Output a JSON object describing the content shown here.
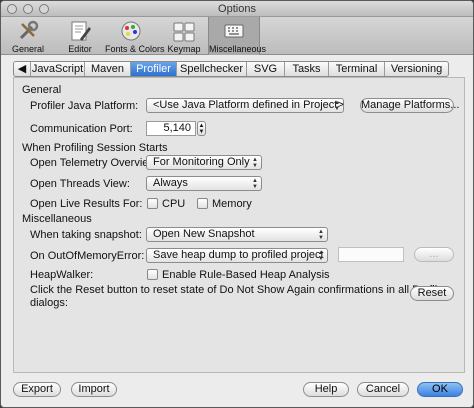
{
  "window": {
    "title": "Options"
  },
  "toolbar": {
    "items": [
      {
        "label": "General",
        "icon": "general-icon"
      },
      {
        "label": "Editor",
        "icon": "editor-icon"
      },
      {
        "label": "Fonts & Colors",
        "icon": "fonts-colors-icon"
      },
      {
        "label": "Keymap",
        "icon": "keymap-icon"
      },
      {
        "label": "Miscellaneous",
        "icon": "miscellaneous-icon",
        "selected": true
      }
    ]
  },
  "tabs": [
    "JavaScript",
    "Maven",
    "Profiler",
    "Spellchecker",
    "SVG",
    "Tasks",
    "Terminal",
    "Versioning"
  ],
  "active_tab": "Profiler",
  "general": {
    "heading": "General",
    "platform_label": "Profiler Java Platform:",
    "platform_value": "<Use Java Platform defined in Project>",
    "manage_button": "Manage Platforms...",
    "port_label": "Communication Port:",
    "port_value": "5,140"
  },
  "session": {
    "heading": "When Profiling Session Starts",
    "telemetry_label": "Open Telemetry Overview:",
    "telemetry_value": "For Monitoring Only",
    "threads_label": "Open Threads View:",
    "threads_value": "Always",
    "live_label": "Open Live Results For:",
    "cpu_label": "CPU",
    "memory_label": "Memory"
  },
  "misc": {
    "heading": "Miscellaneous",
    "snapshot_label": "When taking snapshot:",
    "snapshot_value": "Open New Snapshot",
    "oom_label": "On OutOfMemoryError:",
    "oom_value": "Save heap dump to profiled project",
    "browse_label": "...",
    "heapwalker_label": "HeapWalker:",
    "heapwalker_option": "Enable Rule-Based Heap Analysis",
    "reset_text_line1": "Click the Reset button to reset state of Do Not Show Again confirmations in all Profiler",
    "reset_text_line2": "dialogs:",
    "reset_button": "Reset"
  },
  "footer": {
    "export": "Export",
    "import": "Import",
    "help": "Help",
    "cancel": "Cancel",
    "ok": "OK"
  },
  "colors": {
    "accent": "#3a82e0",
    "selected_tool": "#a9a9a9"
  }
}
